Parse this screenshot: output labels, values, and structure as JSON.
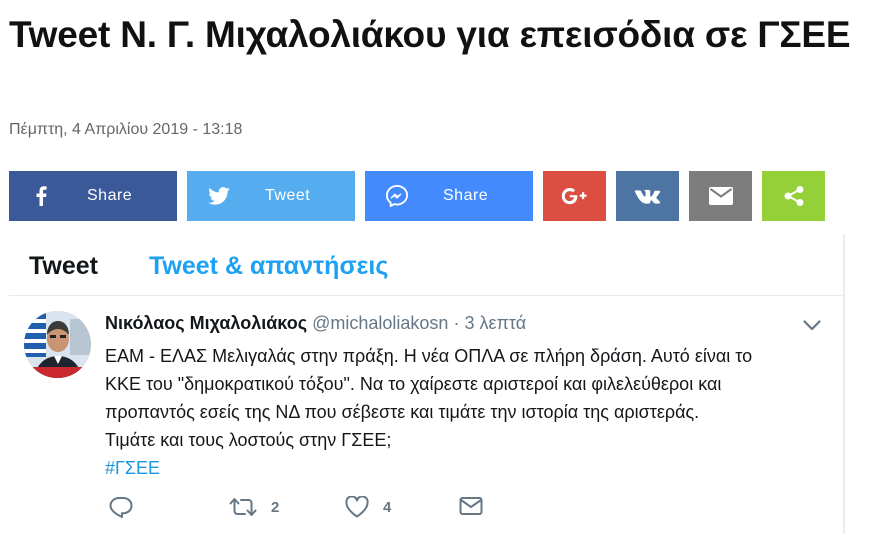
{
  "article": {
    "title": "Tweet Ν. Γ. Μιχαλολιάκου για επεισόδια σε ΓΣΕΕ",
    "date": "Πέμπτη, 4 Απριλίου 2019 - 13:18"
  },
  "share_bar": {
    "facebook_label": "Share",
    "twitter_label": "Tweet",
    "messenger_label": "Share",
    "icons": [
      "facebook-icon",
      "twitter-icon",
      "messenger-icon",
      "google-plus-icon",
      "vk-icon",
      "email-icon",
      "share-icon"
    ],
    "colors": {
      "facebook": "#3b5998",
      "twitter": "#55acee",
      "messenger": "#448aff",
      "google_plus": "#dc4e41",
      "vk": "#4c75a3",
      "email": "#7d7d7d",
      "share": "#95d03a"
    }
  },
  "widget": {
    "tab_tweet": "Tweet",
    "tab_replies": "Tweet & απαντήσεις",
    "accent_color": "#1da1f2"
  },
  "tweet": {
    "author_name": "Νικόλαος Μιχαλολιάκος",
    "author_handle": "@michaloliakosn",
    "separator": "·",
    "time_ago": "3 λεπτά",
    "text_lines": [
      "ΕΑΜ - ΕΛΑΣ Μελιγαλάς στην πράξη. Η νέα ΟΠΛΑ σε πλήρη δράση. Αυτό είναι το",
      "ΚΚΕ του \"δημοκρατικού τόξου\". Να το χαίρεστε αριστεροί και φιλελεύθεροι και",
      "προπαντός εσείς της ΝΔ που σέβεστε και τιμάτε την ιστορία της αριστεράς.",
      "Τιμάτε και τους λοστούς στην ΓΣΕΕ;"
    ],
    "hashtag": "#ΓΣΕΕ",
    "retweet_count": "2",
    "like_count": "4"
  }
}
